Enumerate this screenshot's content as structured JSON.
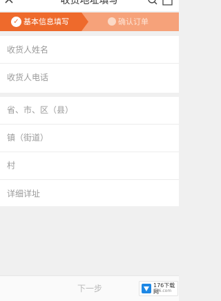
{
  "header": {
    "title": "收货地址填写"
  },
  "steps": {
    "step1_check": "✓",
    "step1_label": "基本信息填写",
    "step2_label": "确认订单"
  },
  "form": {
    "receiver_name_placeholder": "收货人姓名",
    "receiver_phone_placeholder": "收货人电话",
    "region_label": "省、市、区（县）",
    "town_label": "镇（街道）",
    "village_label": "村",
    "detail_address_placeholder": "详细详址"
  },
  "footer": {
    "next_label": "下一步"
  },
  "watermark": {
    "text": "176下载网",
    "sub": "176.com"
  },
  "colors": {
    "accent": "#ee6a2c",
    "accent_light": "#f6a27a"
  }
}
